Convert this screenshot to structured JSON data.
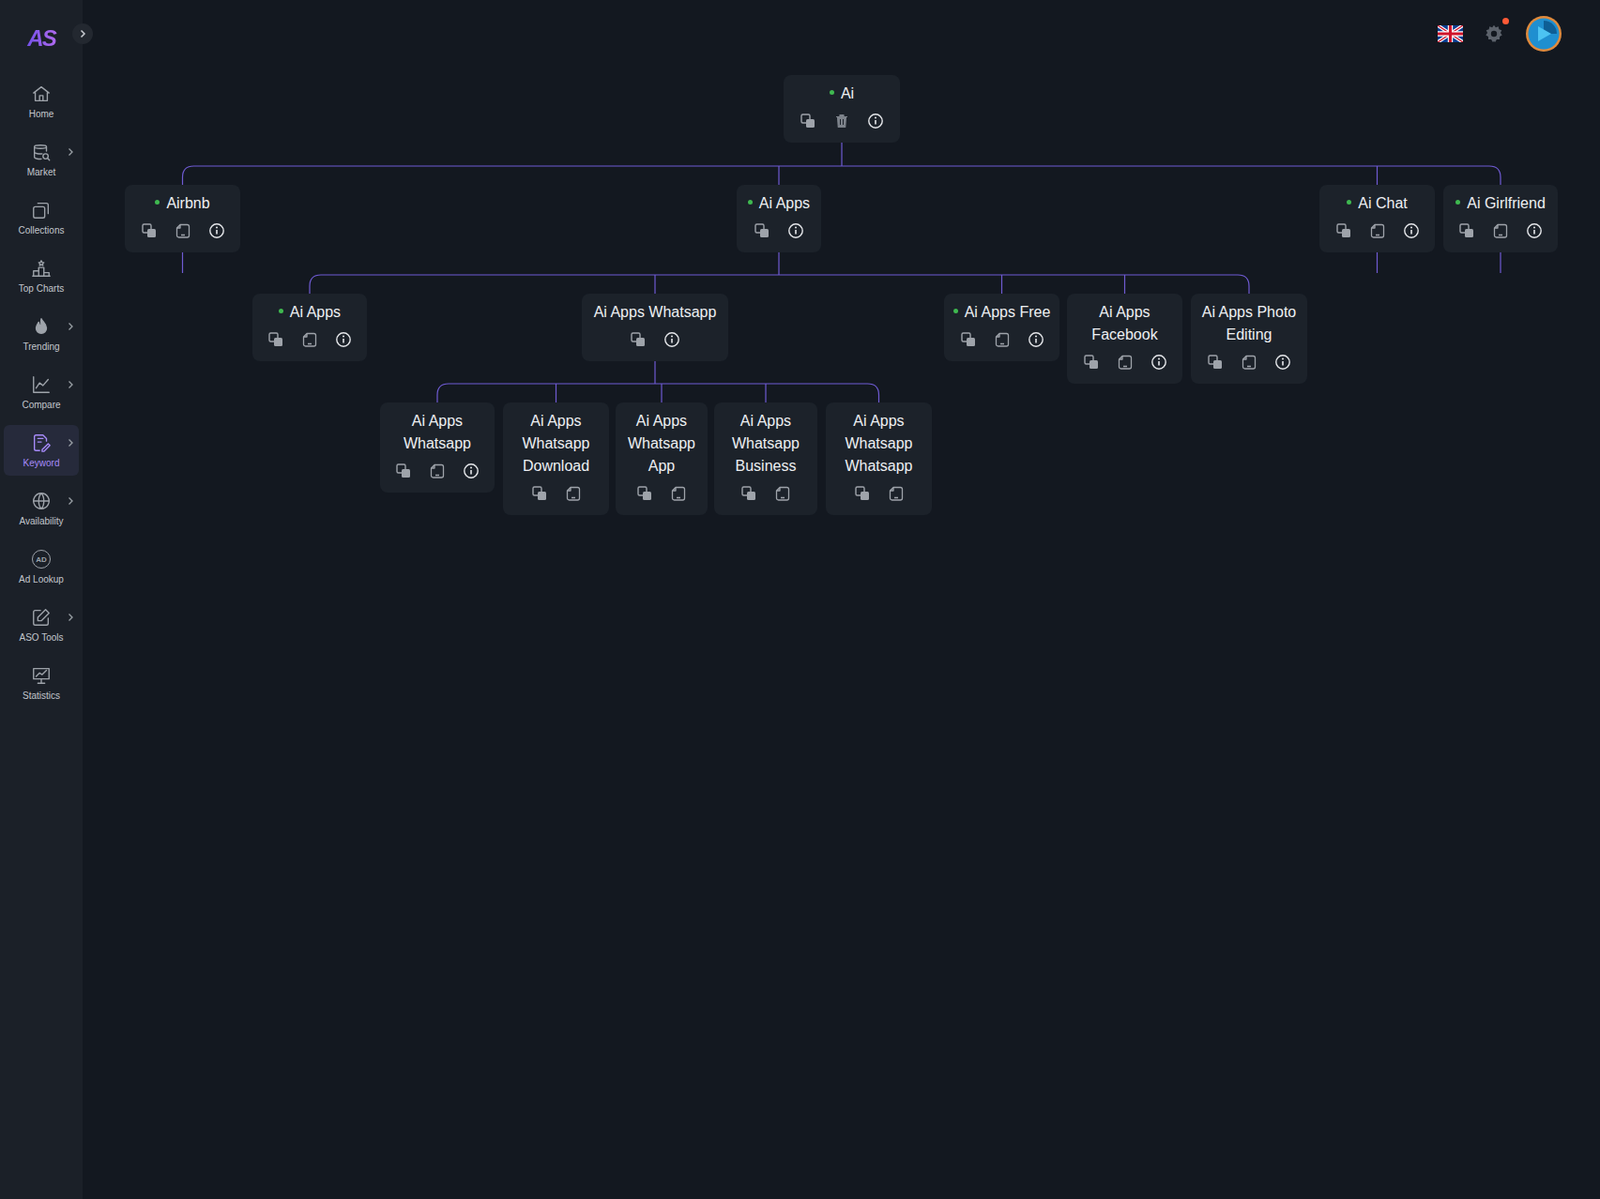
{
  "logo": "AS",
  "sidebar": {
    "items": [
      {
        "label": "Home",
        "expandable": false,
        "selected": false,
        "glyph": ""
      },
      {
        "label": "Market",
        "expandable": true,
        "selected": false,
        "glyph": ""
      },
      {
        "label": "Collections",
        "expandable": false,
        "selected": false,
        "glyph": ""
      },
      {
        "label": "Top Charts",
        "expandable": false,
        "selected": false,
        "glyph": ""
      },
      {
        "label": "Trending",
        "expandable": true,
        "selected": false,
        "glyph": ""
      },
      {
        "label": "Compare",
        "expandable": true,
        "selected": false,
        "glyph": ""
      },
      {
        "label": "Keyword",
        "expandable": true,
        "selected": true,
        "glyph": ""
      },
      {
        "label": "Availability",
        "expandable": true,
        "selected": false,
        "glyph": ""
      },
      {
        "label": "Ad Lookup",
        "expandable": false,
        "selected": false,
        "glyph": "AD"
      },
      {
        "label": "ASO Tools",
        "expandable": true,
        "selected": false,
        "glyph": ""
      },
      {
        "label": "Statistics",
        "expandable": false,
        "selected": false,
        "glyph": ""
      }
    ]
  },
  "header": {
    "notification": true
  },
  "tree": {
    "label": "Ai",
    "dot": true,
    "actions": [
      "copy",
      "delete",
      "info"
    ],
    "collapsed": false,
    "children": [
      {
        "label": "Airbnb",
        "dot": true,
        "actions": [
          "copy",
          "note",
          "info"
        ],
        "collapsed": true,
        "children": []
      },
      {
        "label": "Ai Apps",
        "dot": true,
        "actions": [
          "copy",
          "info"
        ],
        "collapsed": false,
        "children": [
          {
            "label": "Ai Apps",
            "dot": true,
            "actions": [
              "copy",
              "note",
              "info"
            ],
            "collapsed": false,
            "children": []
          },
          {
            "label": "Ai Apps Whatsapp",
            "dot": false,
            "actions": [
              "copy",
              "info"
            ],
            "collapsed": false,
            "children": [
              {
                "label": "Ai Apps Whatsapp",
                "dot": false,
                "actions": [
                  "copy",
                  "note",
                  "info"
                ],
                "collapsed": false,
                "children": []
              },
              {
                "label": "Ai Apps Whatsapp Download",
                "dot": false,
                "actions": [
                  "copy",
                  "note"
                ],
                "collapsed": false,
                "children": []
              },
              {
                "label": "Ai Apps Whatsapp App",
                "dot": false,
                "actions": [
                  "copy",
                  "note"
                ],
                "collapsed": false,
                "children": []
              },
              {
                "label": "Ai Apps Whatsapp Business",
                "dot": false,
                "actions": [
                  "copy",
                  "note"
                ],
                "collapsed": false,
                "children": []
              },
              {
                "label": "Ai Apps Whatsapp Whatsapp",
                "dot": false,
                "actions": [
                  "copy",
                  "note"
                ],
                "collapsed": false,
                "children": []
              }
            ]
          },
          {
            "label": "Ai Apps Free",
            "dot": true,
            "actions": [
              "copy",
              "note",
              "info"
            ],
            "collapsed": false,
            "children": []
          },
          {
            "label": "Ai Apps Facebook",
            "dot": false,
            "actions": [
              "copy",
              "note",
              "info"
            ],
            "collapsed": false,
            "children": []
          },
          {
            "label": "Ai Apps Photo Editing",
            "dot": false,
            "actions": [
              "copy",
              "note",
              "info"
            ],
            "collapsed": false,
            "children": []
          }
        ]
      },
      {
        "label": "Ai Chat",
        "dot": true,
        "actions": [
          "copy",
          "note",
          "info"
        ],
        "collapsed": true,
        "children": []
      },
      {
        "label": "Ai Girlfriend",
        "dot": true,
        "actions": [
          "copy",
          "note",
          "info"
        ],
        "collapsed": true,
        "children": []
      }
    ]
  }
}
